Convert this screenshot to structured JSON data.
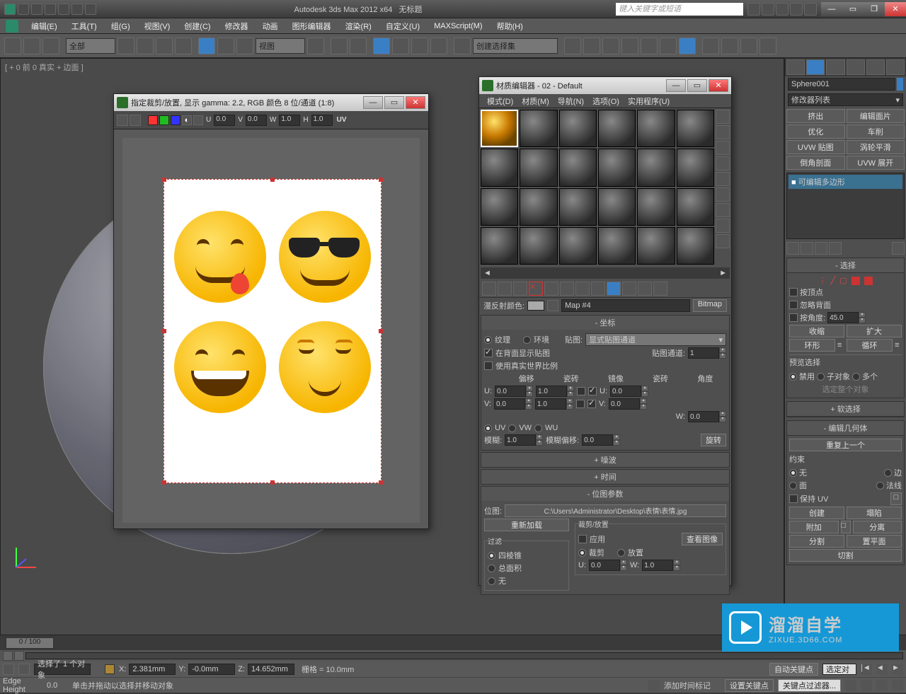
{
  "titlebar": {
    "app": "Autodesk 3ds Max  2012 x64",
    "doc": "无标题",
    "search_placeholder": "键入关键字或短语"
  },
  "menu": [
    "编辑(E)",
    "工具(T)",
    "组(G)",
    "视图(V)",
    "创建(C)",
    "修改器",
    "动画",
    "图形编辑器",
    "渲染(R)",
    "自定义(U)",
    "MAXScript(M)",
    "帮助(H)"
  ],
  "toolbar": {
    "sel_filter": "全部",
    "ref_sys": "视图",
    "named_sel": "创建选择集"
  },
  "viewport": {
    "label": "[ + 0 前 0 真实 + 边面 ]"
  },
  "crop_dialog": {
    "title": "指定裁剪/放置, 显示 gamma: 2.2, RGB 颜色 8 位/通道 (1:8)",
    "u": "0.0",
    "v": "0.0",
    "w": "1.0",
    "h": "1.0",
    "uv": "UV"
  },
  "mat_editor": {
    "title": "材质编辑器 - 02 - Default",
    "menus": [
      "模式(D)",
      "材质(M)",
      "导航(N)",
      "选项(O)",
      "实用程序(U)"
    ],
    "diffuse_label": "漫反射颜色:",
    "map_name": "Map #4",
    "type": "Bitmap",
    "coord_title": "坐标",
    "texture": "纹理",
    "env": "环境",
    "map_label": "贴图:",
    "map_channel_sel": "显式贴图通道",
    "show_back": "在背面显示贴图",
    "map_channel_label": "贴图通道:",
    "map_channel": "1",
    "real_world": "使用真实世界比例",
    "hdr": {
      "offset": "偏移",
      "tile": "瓷砖",
      "mirror": "镜像",
      "tile2": "瓷砖",
      "angle": "角度"
    },
    "u_lbl": "U:",
    "v_lbl": "V:",
    "w_lbl": "W:",
    "u_off": "0.0",
    "u_tile": "1.0",
    "u_ang": "0.0",
    "v_off": "0.0",
    "v_tile": "1.0",
    "v_ang": "0.0",
    "w_ang": "0.0",
    "uv": "UV",
    "vw": "VW",
    "wu": "WU",
    "blur_lbl": "模糊:",
    "blur": "1.0",
    "blur_off_lbl": "模糊偏移:",
    "blur_off": "0.0",
    "rotate": "旋转",
    "noise": "噪波",
    "time": "时间",
    "bitmap_params": "位图参数",
    "bitmap_lbl": "位图:",
    "path": "C:\\Users\\Administrator\\Desktop\\表情\\表情.jpg",
    "reload": "重新加载",
    "filter_title": "过滤",
    "filter_pyr": "四棱锥",
    "filter_sum": "总面积",
    "filter_none": "无",
    "crop_title": "裁剪/放置",
    "apply": "应用",
    "view": "查看图像",
    "crop": "裁剪",
    "place": "放置",
    "cu": "0.0",
    "cw": "1.0"
  },
  "right": {
    "obj_name": "Sphere001",
    "mod_list": "修改器列表",
    "btns": [
      "挤出",
      "编辑面片",
      "优化",
      "车削",
      "UVW 贴图",
      "涡轮平滑",
      "倒角剖面",
      "UVW 展开"
    ],
    "stack_item": "可编辑多边形",
    "rollouts": {
      "select": "选择",
      "by_vertex": "按顶点",
      "ignore_back": "忽略背面",
      "by_angle": "按角度:",
      "angle": "45.0",
      "shrink": "收缩",
      "grow": "扩大",
      "ring": "环形",
      "loop": "循环",
      "preview": "预览选择",
      "disable": "禁用",
      "subobj": "子对象",
      "multi": "多个",
      "sel_whole": "选定整个对象",
      "soft": "软选择",
      "edit_geo": "编辑几何体",
      "repeat": "重复上一个",
      "constrain": "约束",
      "c_none": "无",
      "c_edge": "边",
      "c_face": "面",
      "c_normal": "法线",
      "preserve_uv": "保持 UV",
      "create": "创建",
      "collapse": "塌陷",
      "attach": "附加",
      "detach": "分离",
      "slice_plane": "分割",
      "reset_plane": "置平面",
      "cut": "切割"
    }
  },
  "timeline": {
    "frame": "0 / 100"
  },
  "status": {
    "edge_height": "Edge Height",
    "eh_val": "0.0",
    "sel": "选择了 1 个对象",
    "hint": "单击并拖动以选择并移动对象",
    "x": "2.381mm",
    "y": "-0.0mm",
    "z": "14.652mm",
    "grid": "栅格 = 10.0mm",
    "autokey": "自动关键点",
    "selset": "选定对",
    "addtag": "添加时间标记",
    "setkey": "设置关键点",
    "keyfilter": "关键点过滤器..."
  },
  "watermark": {
    "cn": "溜溜自学",
    "en": "ZIXUE.3D66.COM"
  }
}
